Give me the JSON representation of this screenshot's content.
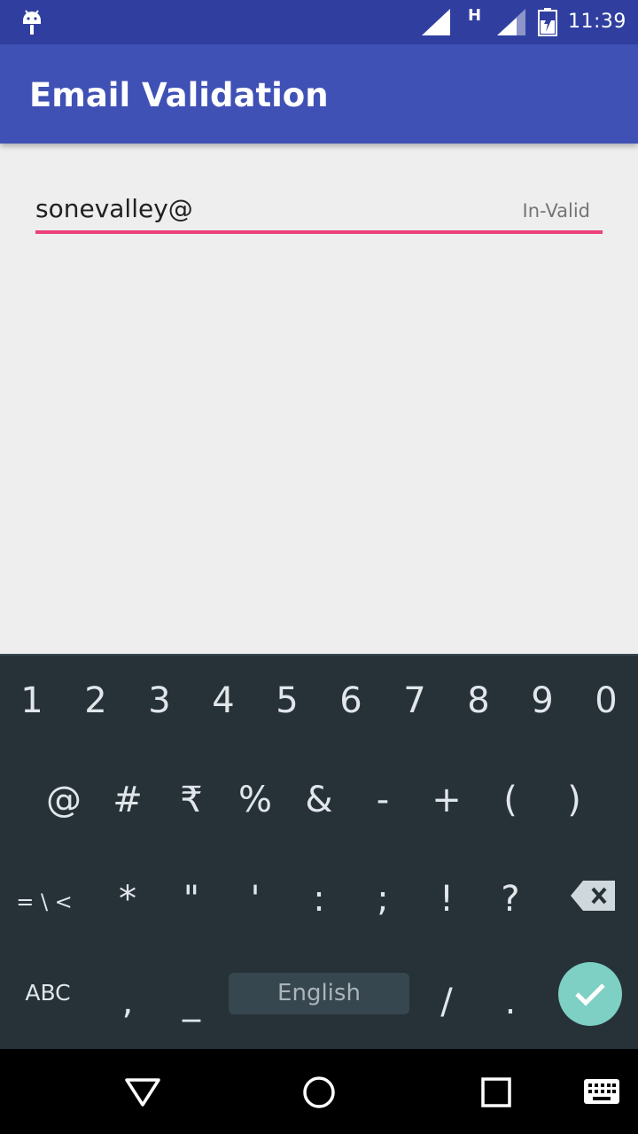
{
  "status_bar": {
    "network_type": "H",
    "time": "11:39"
  },
  "app_bar": {
    "title": "Email Validation"
  },
  "email_field": {
    "value": "sonevalley@",
    "status": "In-Valid",
    "underline_color": "#EC407A"
  },
  "keyboard": {
    "row1": [
      "1",
      "2",
      "3",
      "4",
      "5",
      "6",
      "7",
      "8",
      "9",
      "0"
    ],
    "row2": [
      "@",
      "#",
      "₹",
      "%",
      "&",
      "-",
      "+",
      "(",
      ")"
    ],
    "row3": [
      "= \\ <",
      "*",
      "\"",
      "'",
      ":",
      ";",
      "!",
      "?"
    ],
    "row4": {
      "abc": "ABC",
      "comma": ",",
      "underscore": "_",
      "space": "English",
      "slash": "/",
      "period": "."
    },
    "enter_color": "#7ECFC4"
  },
  "colors": {
    "status_bar": "#303F9F",
    "app_bar": "#3F51B5",
    "keyboard": "#263238"
  }
}
